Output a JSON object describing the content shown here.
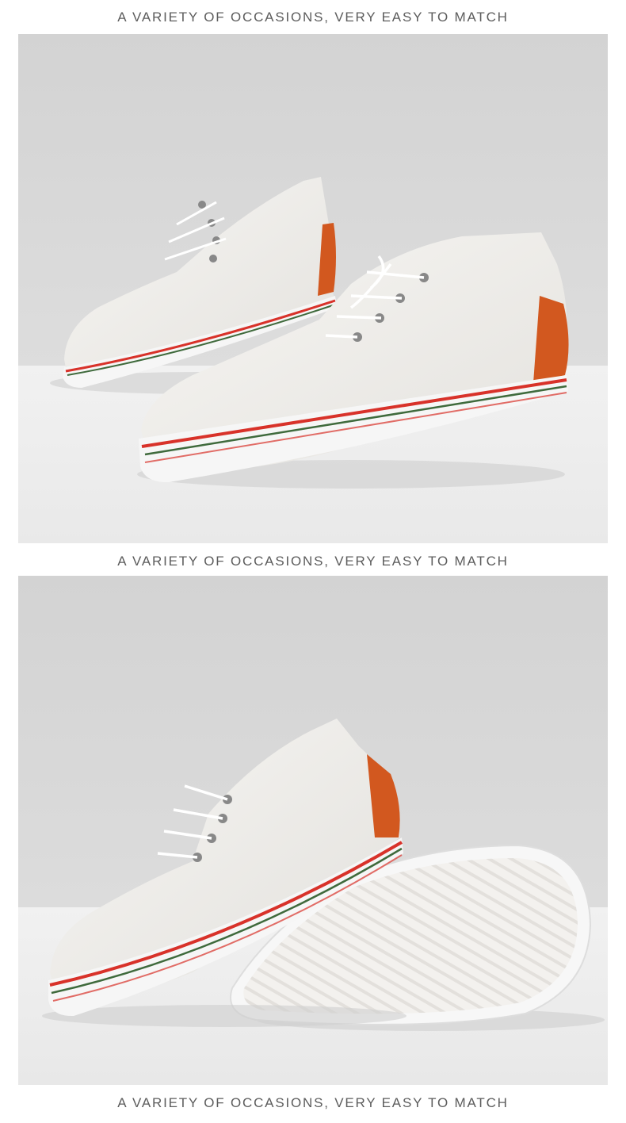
{
  "captions": {
    "top": "A VARIETY OF OCCASIONS, VERY EASY TO MATCH",
    "middle": "A VARIETY OF OCCASIONS, VERY EASY TO MATCH",
    "bottom": "A VARIETY OF OCCASIONS, VERY EASY TO MATCH"
  },
  "photos": [
    {
      "subject": "pair-of-white-canvas-sneakers"
    },
    {
      "subject": "white-sneaker-and-upturned-sole"
    }
  ],
  "colors": {
    "backdrop_top": "#d6d6d6",
    "backdrop_floor": "#eeeeee",
    "canvas": "#f4f2ef",
    "heel_tab": "#d2581f",
    "stripe_red": "#d8322a",
    "stripe_green": "#3f6a3c"
  }
}
